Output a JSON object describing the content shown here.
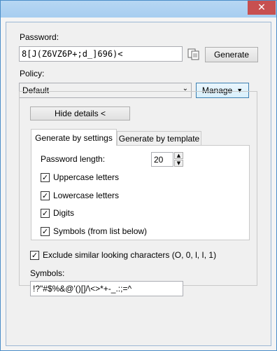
{
  "window": {
    "close_glyph": "✕"
  },
  "password": {
    "label": "Password:",
    "value": "8[J(Z6VZ6P+;d_]696)<",
    "generate_label": "Generate"
  },
  "policy": {
    "label": "Policy:",
    "selected": "Default",
    "manage_label": "Manage"
  },
  "details": {
    "hide_label": "Hide details <"
  },
  "tabs": [
    {
      "label": "Generate by settings"
    },
    {
      "label": "Generate by template"
    }
  ],
  "settings": {
    "length_label": "Password length:",
    "length_value": "20",
    "checks": [
      {
        "label": "Uppercase letters",
        "checked": true
      },
      {
        "label": "Lowercase letters",
        "checked": true
      },
      {
        "label": "Digits",
        "checked": true
      },
      {
        "label": "Symbols (from list below)",
        "checked": true
      }
    ]
  },
  "exclude": {
    "label": "Exclude similar looking characters (O, 0, l, I, 1)",
    "checked": true
  },
  "symbols": {
    "label": "Symbols:",
    "value": "!?\"#$%&@'()[]/\\<>*+-_.:;=^"
  },
  "colors": {
    "close": "#c75050",
    "titlebar": "#a6cdf0"
  }
}
